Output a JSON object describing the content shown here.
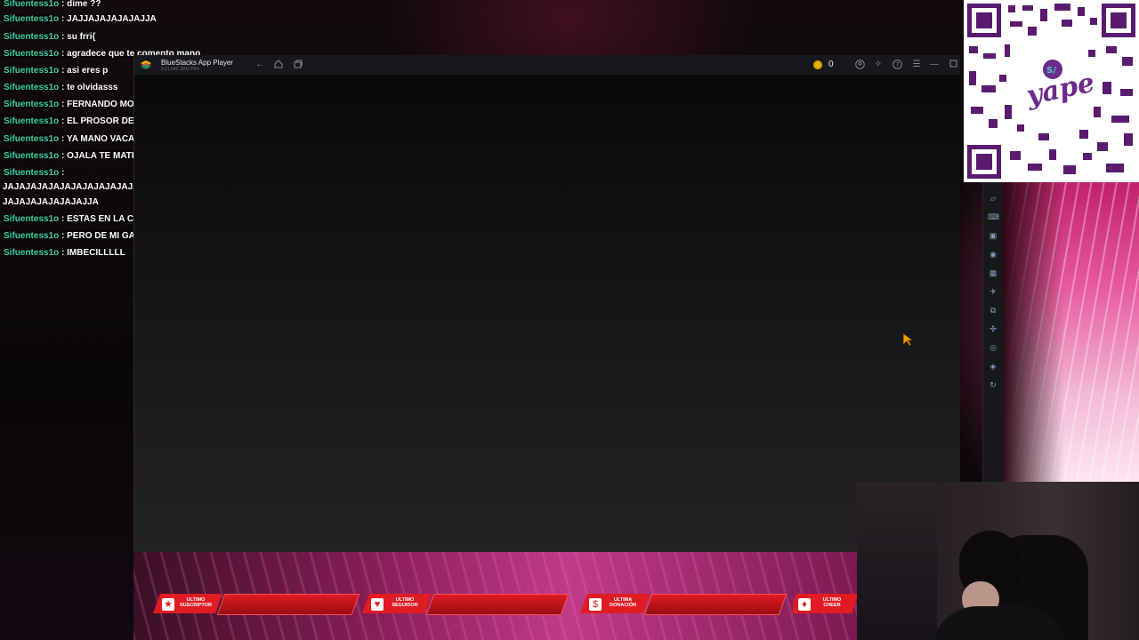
{
  "chat": {
    "messages": [
      {
        "user": "Sifuentess1o",
        "text": "dime ??"
      },
      {
        "user": "Sifuentess1o",
        "text": "JAJJAJAJAJAJAJJA"
      },
      {
        "user": "Sifuentess1o",
        "text": "su frri{"
      },
      {
        "user": "Sifuentess1o",
        "text": "agradece que te comento mano"
      },
      {
        "user": "Sifuentess1o",
        "text": "asi eres p"
      },
      {
        "user": "Sifuentess1o",
        "text": "te olvidasss"
      },
      {
        "user": "Sifuentess1o",
        "text": "FERNANDO MOTAAAA"
      },
      {
        "user": "Sifuentess1o",
        "text": "EL PROSOR DEL BILLAR"
      },
      {
        "user": "Sifuentess1o",
        "text": "YA MANO VACAN"
      },
      {
        "user": "Sifuentess1o",
        "text": "OJALA TE MATEN"
      },
      {
        "user": "Sifuentess1o",
        "text": "",
        "cont": [
          "JAJAJAJAJAJAJAJAJAJAJAJAJAJAJAJAJAJAJAJAJJAJAJAJAJJAJAJA",
          "JAJAJAJAJAJAJAJJA"
        ]
      },
      {
        "user": "Sifuentess1o",
        "text": "ESTAS EN LA CIMA"
      },
      {
        "user": "Sifuentess1o",
        "text": "PERO DE MI GAMPI"
      },
      {
        "user": "Sifuentess1o",
        "text": "IMBECILLLLL"
      }
    ]
  },
  "window": {
    "title": "BlueStacks App Player",
    "subtitle": "5.21.640.1002 P64",
    "coin_count": "0",
    "icons": [
      "back-icon",
      "home-icon",
      "multi-instance-icon",
      "account-icon",
      "performance-icon",
      "help-icon",
      "menu-icon",
      "minimize-icon",
      "maximize-icon"
    ]
  },
  "sidebar": {
    "icons": [
      "toolbar-icon",
      "keyboard-icon",
      "screenshot-icon",
      "record-icon",
      "media-icon",
      "airplane-icon",
      "multi-instance-icon",
      "eco-icon",
      "location-icon",
      "layers-icon",
      "sync-icon"
    ]
  },
  "alerts": [
    {
      "label": "ULTIMO SUSCRIPTOR",
      "icon": "star-icon"
    },
    {
      "label": "ULTIMO SEGUIDOR",
      "icon": "heart-icon"
    },
    {
      "label": "ULTIMA DONACIÓN",
      "icon": "dollar-icon"
    },
    {
      "label": "ULTIMO CHEER",
      "icon": "diamond-icon"
    }
  ],
  "qr": {
    "brand": "yape",
    "badge": "S/"
  },
  "colors": {
    "username": "#3fd1a8",
    "alert": "#e11b22",
    "coin": "#f0b400",
    "cursor": "#f0a000"
  }
}
